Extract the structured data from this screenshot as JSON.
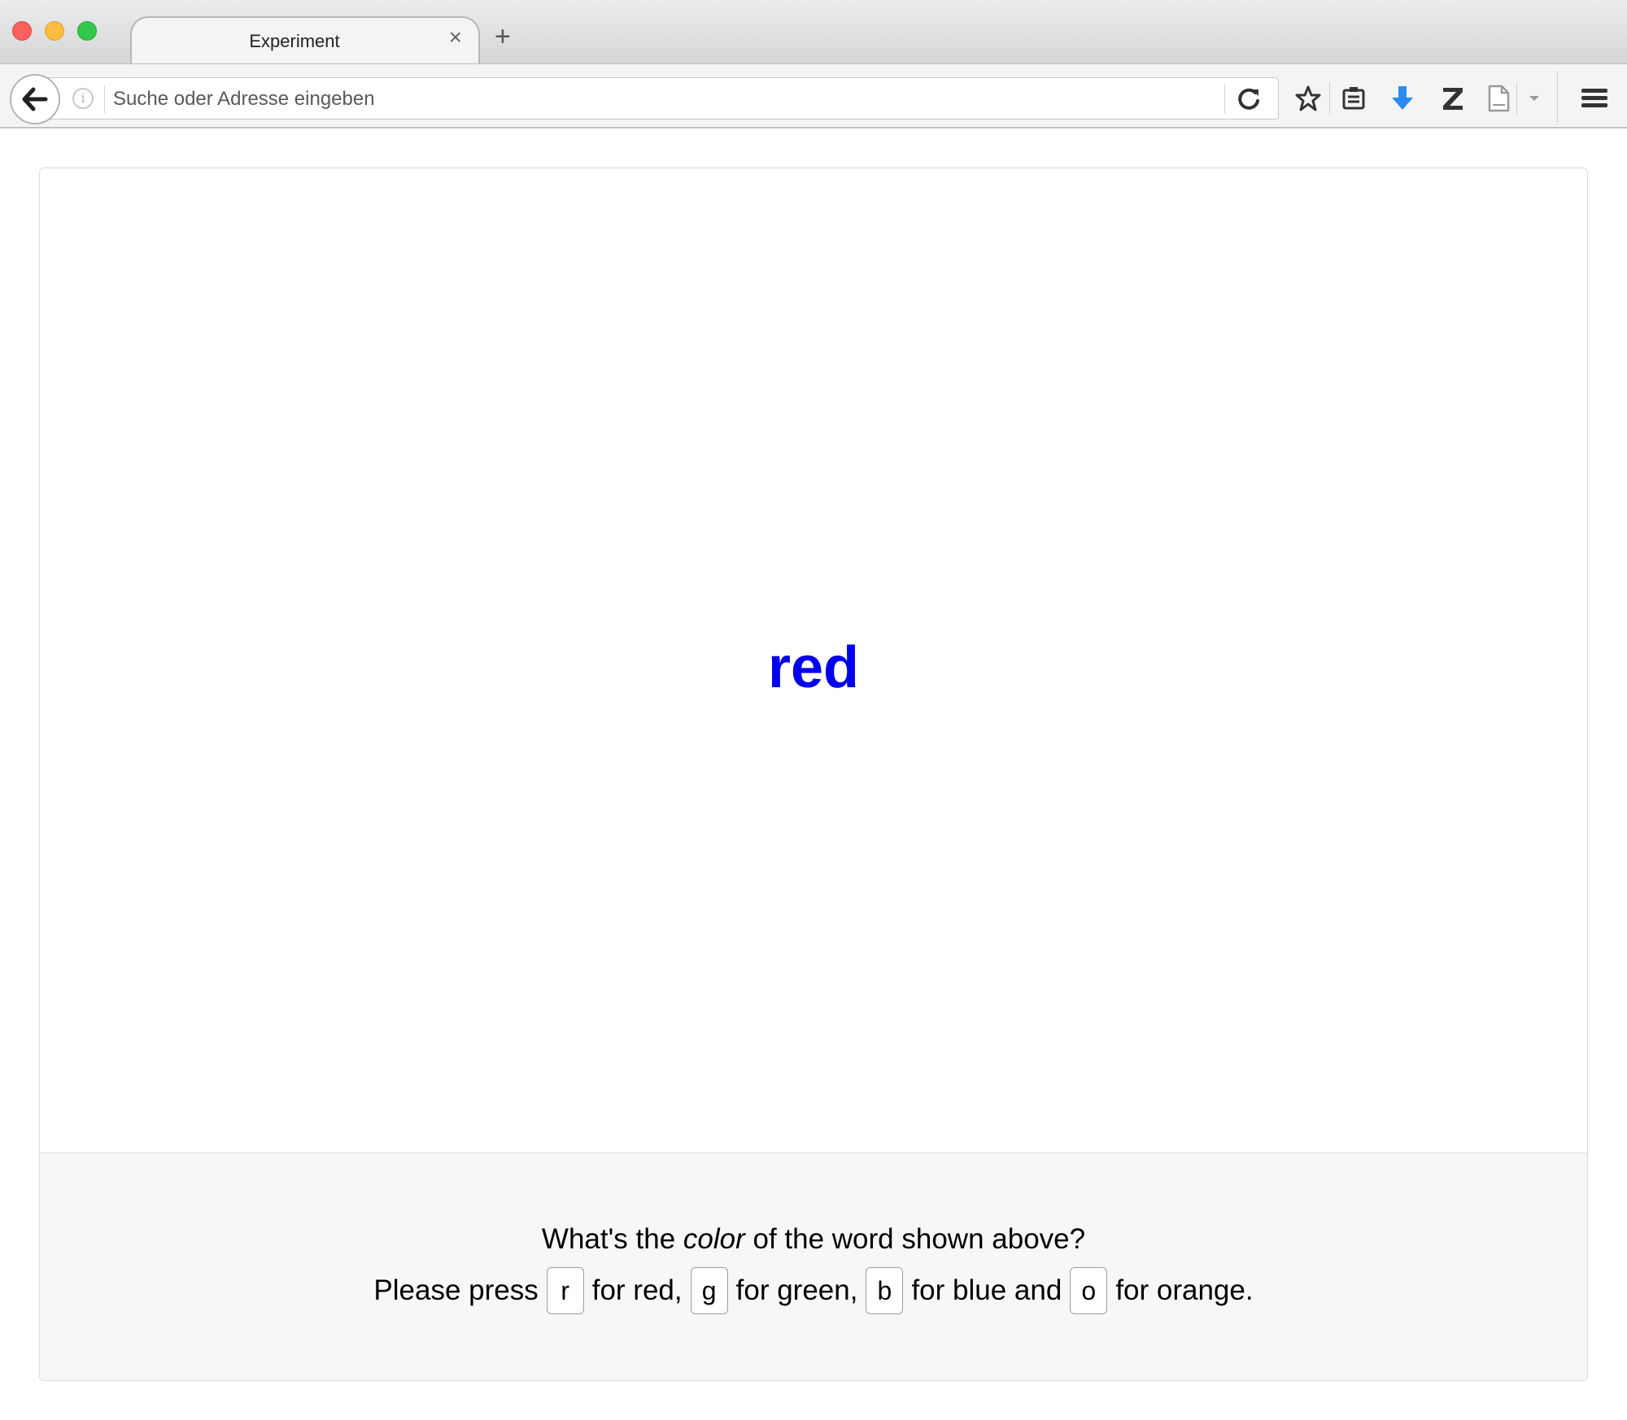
{
  "browser": {
    "tab_title": "Experiment",
    "tab_close": "×",
    "new_tab": "+",
    "url_placeholder": "Suche oder Adresse eingeben",
    "info_glyph": "i",
    "accent_download": "#2a8cf2"
  },
  "experiment": {
    "stimulus_word": "red",
    "stimulus_color": "#0000ee",
    "question_before": "What's the ",
    "question_emphasis": "color",
    "question_after": " of the word shown above?",
    "instruction_prefix": "Please press",
    "options": [
      {
        "key": "r",
        "text": "for red,"
      },
      {
        "key": "g",
        "text": "for green,"
      },
      {
        "key": "b",
        "text": "for blue and"
      },
      {
        "key": "o",
        "text": "for orange."
      }
    ]
  }
}
